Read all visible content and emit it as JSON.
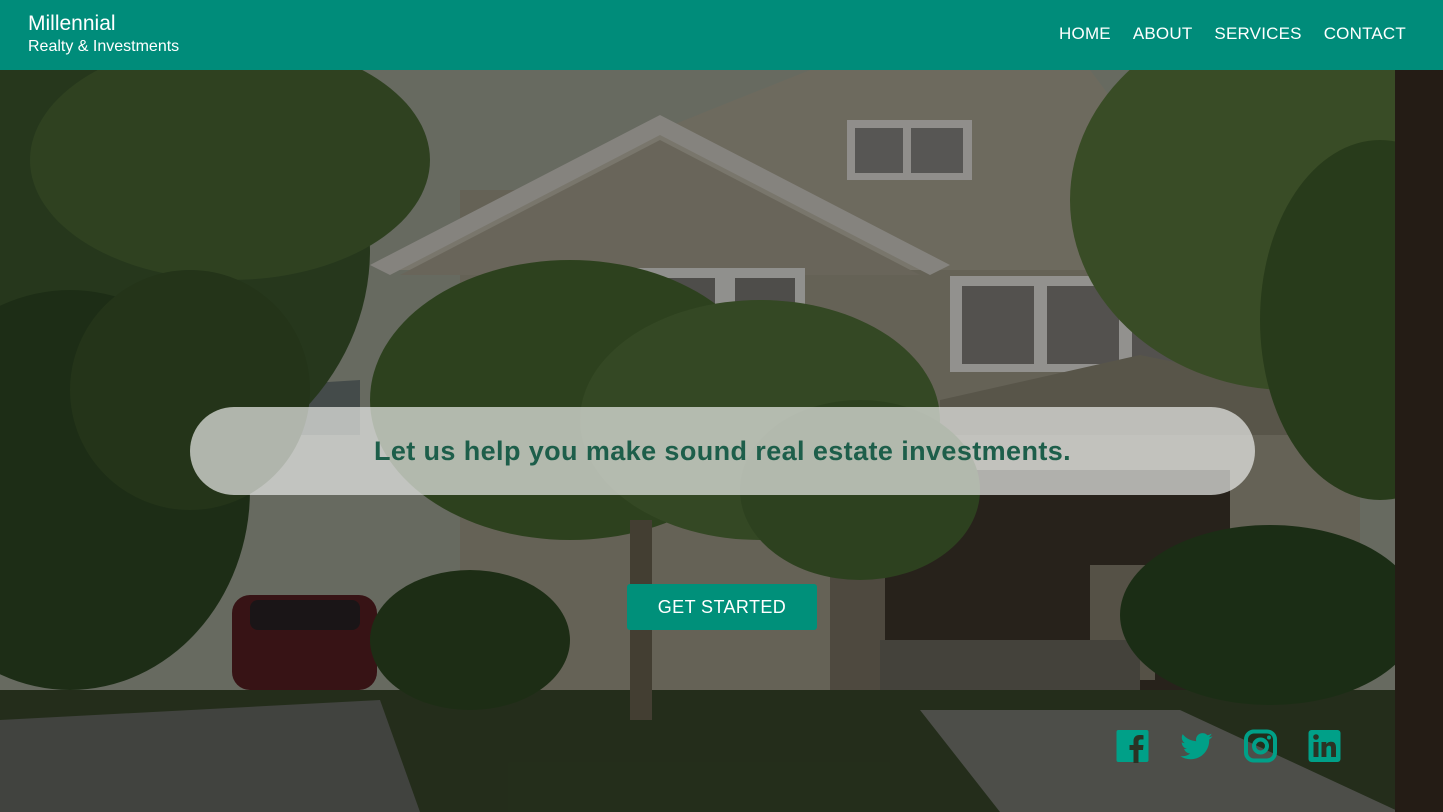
{
  "brand": {
    "name": "Millennial",
    "tagline": "Realty & Investments"
  },
  "nav": {
    "items": [
      {
        "label": "HOME"
      },
      {
        "label": "ABOUT"
      },
      {
        "label": "SERVICES"
      },
      {
        "label": "CONTACT"
      }
    ]
  },
  "hero": {
    "headline": "Let us help you make sound real estate investments.",
    "cta_label": "GET STARTED",
    "background_image": "house-with-trees-photo"
  },
  "social": {
    "icons": [
      "facebook-icon",
      "twitter-icon",
      "instagram-icon",
      "linkedin-icon"
    ]
  },
  "colors": {
    "brand": "#008c7a",
    "headline_text": "#1d5e4a",
    "social_icon": "#00a088",
    "nav_text": "#ffffff"
  }
}
